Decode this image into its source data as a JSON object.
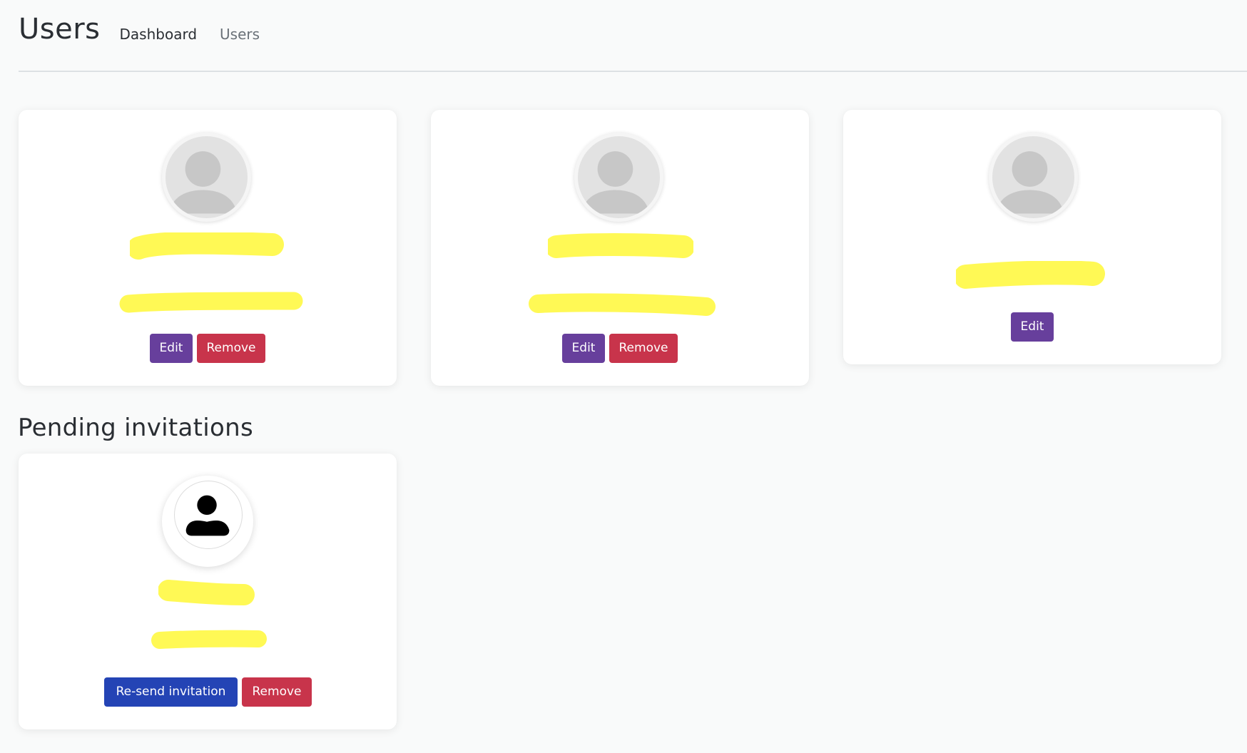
{
  "header": {
    "title": "Users",
    "breadcrumbs": [
      "Dashboard",
      "Users"
    ]
  },
  "users": [
    {
      "name": "",
      "email": "",
      "actions": {
        "edit": "Edit",
        "remove": "Remove"
      }
    },
    {
      "name": "",
      "email": "",
      "actions": {
        "edit": "Edit",
        "remove": "Remove"
      }
    },
    {
      "name": "",
      "actions": {
        "edit": "Edit"
      }
    }
  ],
  "pending": {
    "title": "Pending invitations",
    "invitations": [
      {
        "name": "",
        "email": "",
        "actions": {
          "resend": "Re-send invitation",
          "remove": "Remove"
        }
      }
    ]
  },
  "colors": {
    "edit": "#673f9c",
    "remove": "#c8344b",
    "resend": "#2444b5",
    "redaction": "#fff955"
  },
  "icons": {
    "user_avatar": "person-silhouette-icon",
    "invite_avatar": "person-icon"
  }
}
